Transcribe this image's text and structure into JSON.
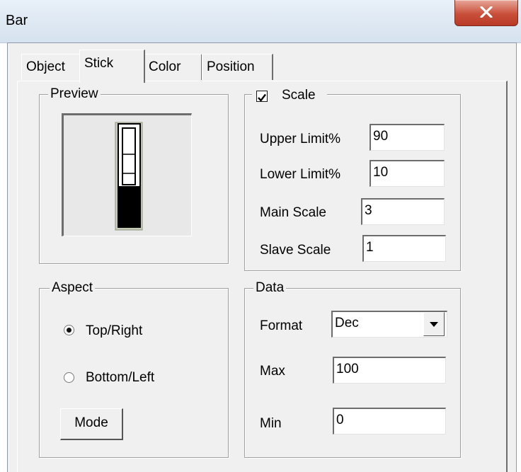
{
  "window": {
    "title": "Bar",
    "close_glyph": "X"
  },
  "tabs": [
    {
      "label": "Object",
      "active": false
    },
    {
      "label": "Stick",
      "active": true
    },
    {
      "label": "Color",
      "active": false
    },
    {
      "label": "Position",
      "active": false
    }
  ],
  "preview": {
    "label": "Preview"
  },
  "scale": {
    "label": "Scale",
    "checked": true,
    "upper_limit_label": "Upper Limit%",
    "upper_limit_value": "90",
    "lower_limit_label": "Lower Limit%",
    "lower_limit_value": "10",
    "main_scale_label": "Main Scale",
    "main_scale_value": "3",
    "slave_scale_label": "Slave Scale",
    "slave_scale_value": "1"
  },
  "aspect": {
    "label": "Aspect",
    "top_right_label": "Top/Right",
    "bottom_left_label": "Bottom/Left",
    "selected": "Top/Right",
    "mode_button": "Mode"
  },
  "data": {
    "label": "Data",
    "format_label": "Format",
    "format_value": "Dec",
    "max_label": "Max",
    "max_value": "100",
    "min_label": "Min",
    "min_value": "0"
  },
  "icons": {
    "close": "close-x-icon",
    "check": "checkmark-icon",
    "dropdown": "triangle-down-icon"
  }
}
